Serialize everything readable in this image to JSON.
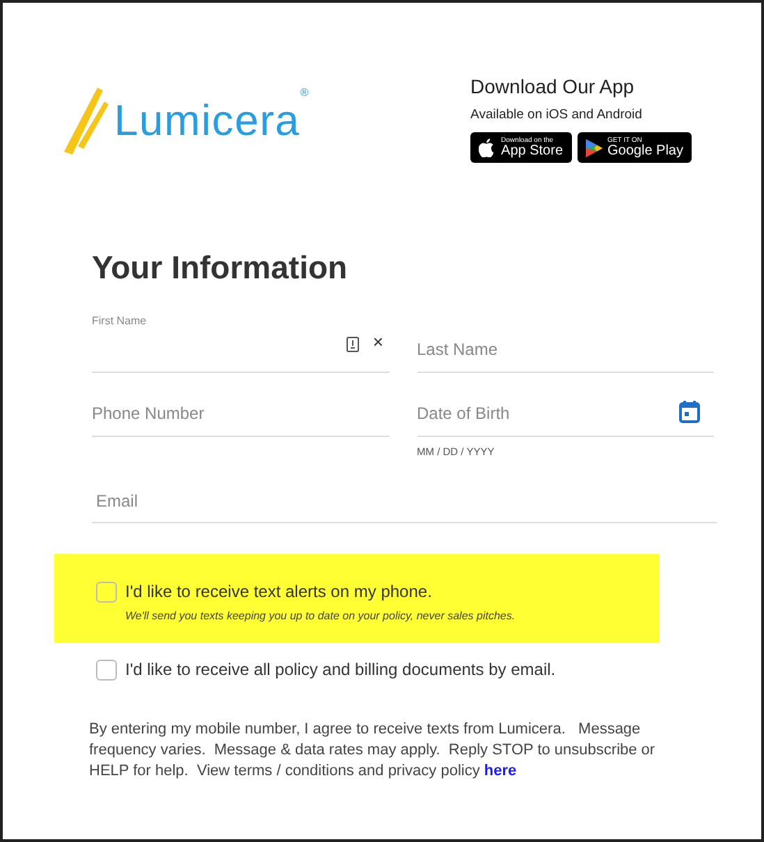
{
  "logo": {
    "name": "Lumicera",
    "mark": "®"
  },
  "app_promo": {
    "title": "Download Our App",
    "subtitle": "Available on iOS and Android",
    "badges": [
      {
        "kind": "apple",
        "small": "Download on the",
        "big": "App Store"
      },
      {
        "kind": "google",
        "small": "GET IT ON",
        "big": "Google Play"
      }
    ]
  },
  "heading": "Your Information",
  "fields": [
    {
      "kind": "floating",
      "label": "First Name",
      "clear": "×"
    },
    {
      "kind": "text",
      "placeholder": "Last Name"
    },
    {
      "kind": "text",
      "placeholder": "Phone Number"
    },
    {
      "kind": "date",
      "placeholder": "Date of Birth",
      "hint": "MM / DD / YYYY"
    },
    {
      "kind": "wide",
      "placeholder": "Email"
    }
  ],
  "options": [
    {
      "label": "I'd like to receive text alerts on my phone.",
      "note": "We'll send you texts keeping you up to date on your policy, never sales pitches.",
      "checked": false,
      "highlighted": true
    },
    {
      "label": "I'd like to receive all policy and billing documents by email.",
      "checked": false,
      "highlighted": false
    }
  ],
  "disclaimer": {
    "text": "By entering my mobile number, I agree to receive texts from Lumicera.   Message frequency varies.  Message & data rates may apply.  Reply STOP to unsubscribe or HELP for help.  View terms / conditions and privacy policy",
    "link": "here"
  }
}
